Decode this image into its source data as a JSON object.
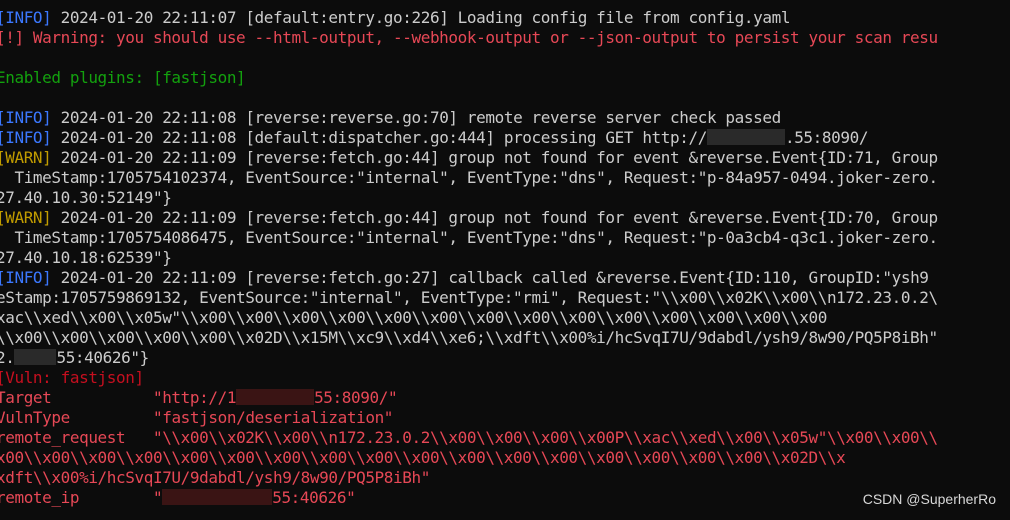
{
  "terminal": {
    "l1": {
      "tag": "[INFO]",
      "ts": "2024-01-20 22:11:07",
      "msg": "[default:entry.go:226] Loading config file from config.yaml"
    },
    "l2": "[!] Warning: you should use --html-output, --webhook-output or --json-output to persist your scan resu",
    "l3": "Enabled plugins: [fastjson]",
    "l4": {
      "tag": "[INFO]",
      "ts": "2024-01-20 22:11:08",
      "msg": "[reverse:reverse.go:70] remote reverse server check passed"
    },
    "l5": {
      "tag": "[INFO]",
      "ts": "2024-01-20 22:11:08",
      "msg_a": "[default:dispatcher.go:444] processing GET http://",
      "msg_b": ".55:8090/"
    },
    "l6": {
      "tag": "[WARN]",
      "ts": "2024-01-20 22:11:09",
      "msg": "[reverse:fetch.go:44] group not found for event &reverse.Event{ID:71, Group"
    },
    "l7": "TimeStamp:1705754102374, EventSource:\"internal\", EventType:\"dns\", Request:\"p-84a957-0494.joker-zero.",
    "l8": "27.40.10.30:52149\"}",
    "l9": {
      "tag": "[WARN]",
      "ts": "2024-01-20 22:11:09",
      "msg": "[reverse:fetch.go:44] group not found for event &reverse.Event{ID:70, Group"
    },
    "l10": "TimeStamp:1705754086475, EventSource:\"internal\", EventType:\"dns\", Request:\"p-0a3cb4-q3c1.joker-zero.",
    "l11": "27.40.10.18:62539\"}",
    "l12": {
      "tag": "[INFO]",
      "ts": "2024-01-20 22:11:09",
      "msg": "[reverse:fetch.go:27] callback called &reverse.Event{ID:110, GroupID:\"ysh9"
    },
    "l13": "eStamp:1705759869132, EventSource:\"internal\", EventType:\"rmi\", Request:\"\\\\x00\\\\x02K\\\\x00\\\\n172.23.0.2\\",
    "l14": "xac\\\\xed\\\\x00\\\\x05w\"\\\\x00\\\\x00\\\\x00\\\\x00\\\\x00\\\\x00\\\\x00\\\\x00\\\\x00\\\\x00\\\\x00\\\\x00\\\\x00\\\\x00",
    "l15": "\\\\x00\\\\x00\\\\x00\\\\x00\\\\x00\\\\x02D\\\\x15M\\\\xc9\\\\xd4\\\\xe6;\\\\xdft\\\\x00%i/hcSvqI7U/9dabdl/ysh9/8w90/PQ5P8iBh\"",
    "l16_a": "2.",
    "l16_b": "55:40626\"}",
    "vuln_header": "[Vuln: fastjson]",
    "target_label": "Target",
    "target_a": "\"http://1",
    "target_b": "55:8090/\"",
    "vulntype_label": "VulnType",
    "vulntype": "\"fastjson/deserialization\"",
    "remote_request_label": "remote_request",
    "remote_request": "\"\\\\x00\\\\x02K\\\\x00\\\\n172.23.0.2\\\\x00\\\\x00\\\\x00\\\\x00P\\\\xac\\\\xed\\\\x00\\\\x05w\"\\\\x00\\\\x00\\\\",
    "rr_cont1": "x00\\\\x00\\\\x00\\\\x00\\\\x00\\\\x00\\\\x00\\\\x00\\\\x00\\\\x00\\\\x00\\\\x00\\\\x00\\\\x00\\\\x00\\\\x00\\\\x00\\\\x02D\\\\x",
    "rr_cont2": "xdft\\\\x00%i/hcSvqI7U/9dabdl/ysh9/8w90/PQ5P8iBh\"",
    "remote_ip_label": "remote_ip",
    "remote_ip_a": "\"",
    "remote_ip_b": "55:40626\""
  },
  "watermark": "CSDN @SuperherRo"
}
